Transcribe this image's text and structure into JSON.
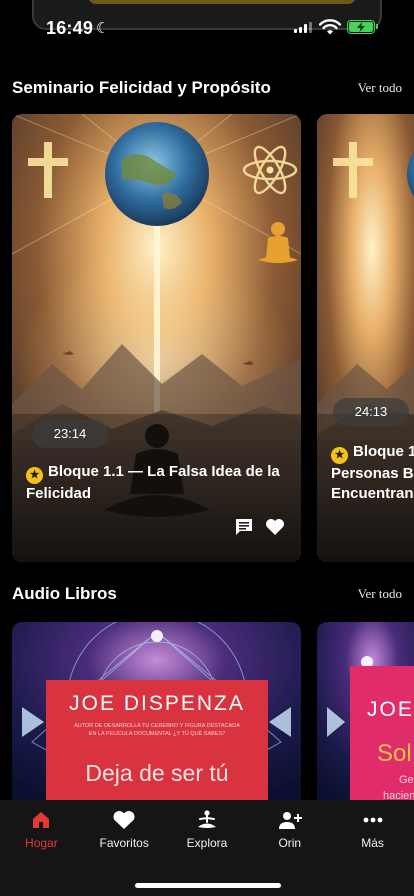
{
  "status": {
    "time": "16:49"
  },
  "sections": {
    "seminario": {
      "title": "Seminario Felicidad y Propósito",
      "see_all": "Ver todo"
    },
    "audiolibros": {
      "title": "Audio Libros",
      "see_all": "Ver todo"
    }
  },
  "cards": [
    {
      "duration": "23:14",
      "title": "Bloque 1.1 — La Falsa Idea de la Felicidad"
    },
    {
      "duration": "24:13",
      "title_line1": "Bloque 1",
      "title_line2": "Personas B",
      "title_line3": "Encuentran"
    }
  ],
  "audiobooks": [
    {
      "author": "JOE DISPENZA",
      "subtitle_line1": "AUTOR DE DESARROLLA TU CEREBRO Y FIGURA DESTACADA",
      "subtitle_line2": "EN LA PELÍCULA DOCUMENTAL ¿Y TÚ QUÉ SABES?",
      "title": "Deja de ser tú"
    },
    {
      "author": "JOE",
      "title_partial": "Sol",
      "sub1": "Ge",
      "sub2": "hacien"
    }
  ],
  "tabs": [
    {
      "label": "Hogar",
      "icon": "home-icon",
      "active": true
    },
    {
      "label": "Favoritos",
      "icon": "heart-icon"
    },
    {
      "label": "Explora",
      "icon": "meditation-icon"
    },
    {
      "label": "Orin",
      "icon": "add-user-icon"
    },
    {
      "label": "Más",
      "icon": "more-icon"
    }
  ],
  "colors": {
    "accent": "#e53935",
    "badge": "#f3c21b",
    "battery": "#46d35a"
  }
}
